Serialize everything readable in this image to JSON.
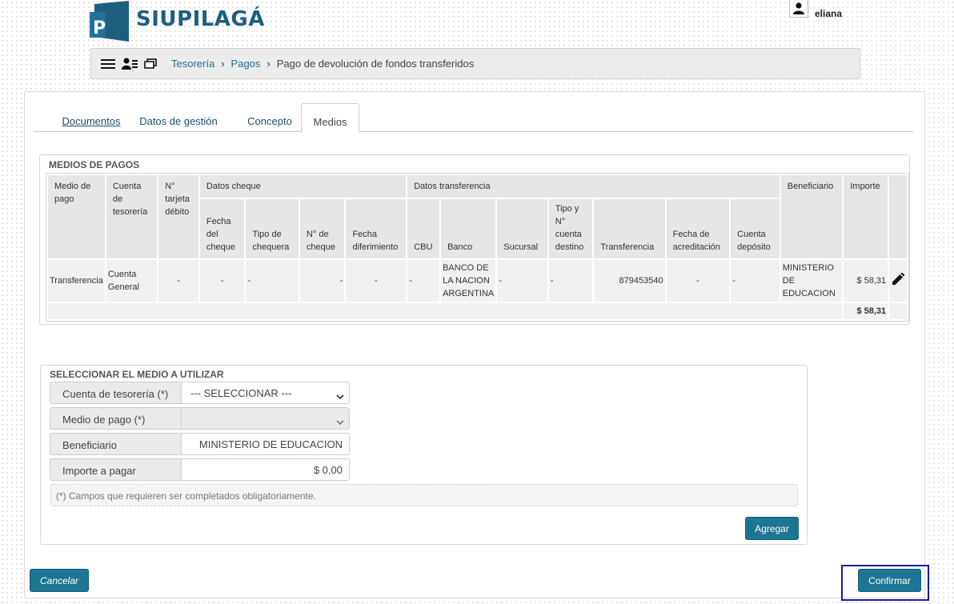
{
  "app": {
    "logo_letter": "P",
    "logo_text": "SIUPILAGÁ",
    "user_name": "eliana",
    "brand_color": "#1d5f80",
    "accent_color": "#1c7593"
  },
  "breadcrumb": {
    "icons": [
      "menu-icon",
      "user-list-icon",
      "windows-icon"
    ],
    "items": [
      "Tesorería",
      "Pagos"
    ],
    "current": "Pago de devolución de fondos transferidos"
  },
  "tabs": [
    {
      "label": "Documentos",
      "active": false
    },
    {
      "label": "Datos de gestión",
      "active": false
    },
    {
      "label": "Concepto",
      "active": false
    },
    {
      "label": "Medios",
      "active": true
    }
  ],
  "medios_pagos": {
    "title": "MEDIOS DE PAGOS",
    "group_headers": {
      "cheque": "Datos cheque",
      "transferencia": "Datos transferencia"
    },
    "columns": {
      "medio": "Medio de pago",
      "cuenta": "Cuenta de tesorería",
      "tarjeta": "N° tarjeta débito",
      "fecha_cheque": "Fecha del cheque",
      "tipo_chequera": "Tipo de chequera",
      "nro_cheque": "N° de cheque",
      "fecha_diferimiento": "Fecha diferimiento",
      "cbu": "CBU",
      "banco": "Banco",
      "sucursal": "Sucursal",
      "tipo_cuenta": "Tipo y N° cuenta destino",
      "transferencia": "Transferencia",
      "fecha_acreditacion": "Fecha de acreditación",
      "cuenta_deposito": "Cuenta depósito",
      "beneficiario": "Beneficiario",
      "importe": "Importe"
    },
    "row": {
      "medio": "Transferencia",
      "cuenta": "Cuenta General",
      "tarjeta": "-",
      "fecha_cheque": "-",
      "tipo_chequera": "-",
      "nro_cheque": "-",
      "fecha_diferimiento": "-",
      "cbu": "-",
      "banco": "BANCO DE LA NACION ARGENTINA",
      "sucursal": "-",
      "tipo_cuenta": "-",
      "transferencia": "879453540",
      "fecha_acreditacion": "-",
      "cuenta_deposito": "-",
      "beneficiario": "MINISTERIO DE EDUCACION",
      "importe": "$ 58,31"
    },
    "total": "$ 58,31"
  },
  "selector": {
    "title": "SELECCIONAR EL MEDIO A UTILIZAR",
    "fields": {
      "cuenta_label": "Cuenta de tesorería (*)",
      "cuenta_value": "--- SELECCIONAR ---",
      "medio_label": "Medio de pago (*)",
      "medio_value": "",
      "beneficiario_label": "Beneficiario",
      "beneficiario_value": "MINISTERIO DE EDUCACION",
      "importe_label": "Importe a pagar",
      "importe_value": "$ 0,00"
    },
    "note": "(*) Campos que requieren ser completados obligatoriamente.",
    "agregar_label": "Agregar"
  },
  "footer": {
    "cancelar_label": "Cancelar",
    "confirmar_label": "Confirmar"
  }
}
